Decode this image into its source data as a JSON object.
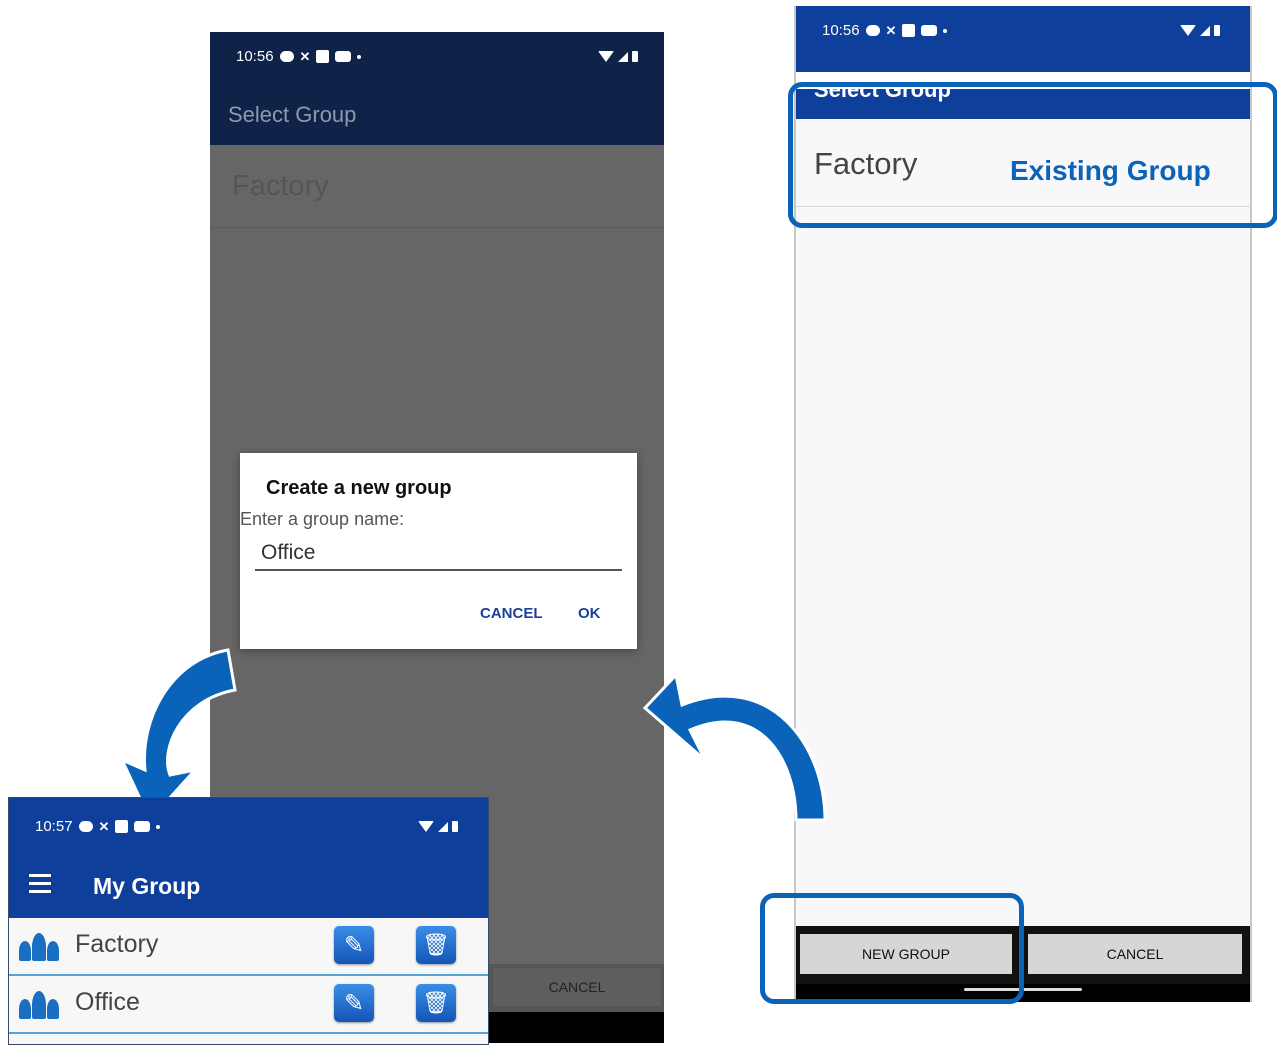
{
  "colors": {
    "accent": "#0a63b8",
    "appbar": "#0e3f9a"
  },
  "middle_screen": {
    "status_time": "10:56",
    "title": "Select Group",
    "list_item": "Factory",
    "bottom_cancel": "CANCEL",
    "dialog": {
      "title": "Create a new group",
      "label": "Enter a group name:",
      "input_value": "Office",
      "cancel": "CANCEL",
      "ok": "OK"
    }
  },
  "right_screen": {
    "status_time": "10:56",
    "title": "Select Group",
    "list_item": "Factory",
    "callout_label": "Existing Group",
    "new_group_button": "NEW GROUP",
    "cancel_button": "CANCEL"
  },
  "bottom_left_screen": {
    "status_time": "10:57",
    "title": "My Group",
    "groups": [
      {
        "name": "Factory",
        "icon": "group-icon"
      },
      {
        "name": "Office",
        "icon": "group-icon"
      }
    ]
  }
}
